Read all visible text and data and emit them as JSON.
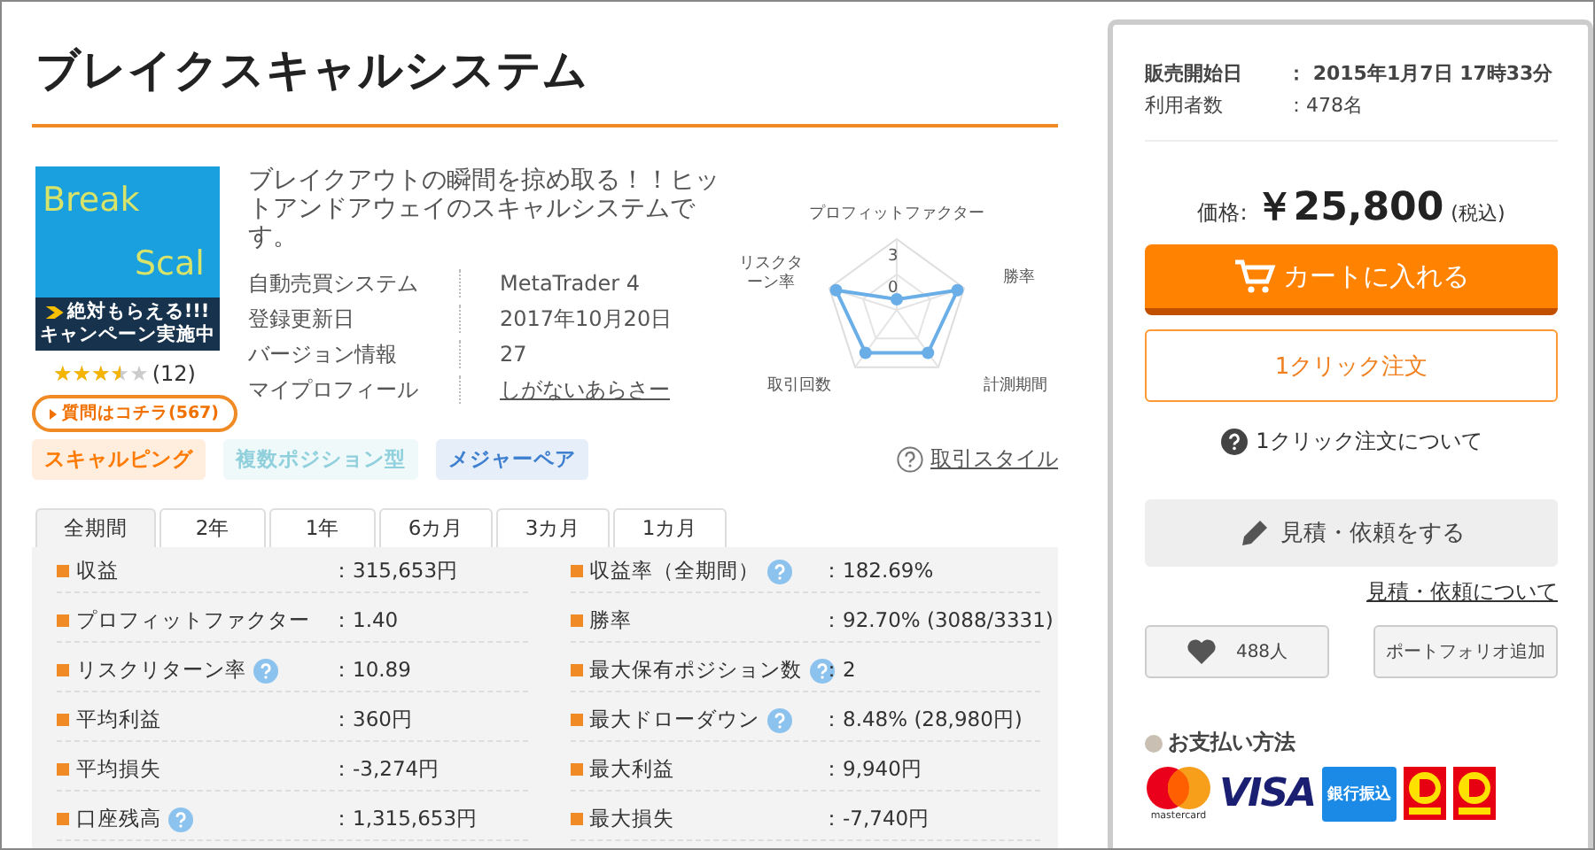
{
  "title": "ブレイクスキャルシステム",
  "product_image": {
    "lines": [
      "Break",
      "Scal"
    ],
    "banner": [
      "絶対もらえる!!!",
      "キャンペーン実施中"
    ]
  },
  "rating": {
    "stars": 3.5,
    "count": "(12)"
  },
  "question_button": "質問はコチラ(567)",
  "description": "ブレイクアウトの瞬間を掠め取る！！ヒットアンドアウェイのスキャルシステムです。",
  "info": [
    {
      "label": "自動売買システム",
      "value": "MetaTrader 4",
      "link": false
    },
    {
      "label": "登録更新日",
      "value": "2017年10月20日",
      "link": false
    },
    {
      "label": "バージョン情報",
      "value": "27",
      "link": false
    },
    {
      "label": "マイプロフィール",
      "value": "しがないあらさー",
      "link": true
    }
  ],
  "radar": {
    "axes": [
      "プロフィットファクター",
      "勝率",
      "計測期間",
      "取引回数",
      "リスクターン率"
    ],
    "ticks": [
      "3",
      "0"
    ]
  },
  "tags": [
    {
      "label": "スキャルピング",
      "color": "#ff7a00"
    },
    {
      "label": "複数ポジション型",
      "color": "#8fd0dc"
    },
    {
      "label": "メジャーペア",
      "color": "#3f7fd0"
    }
  ],
  "style_link": "取引スタイル",
  "tabs": [
    {
      "label": "全期間",
      "selected": true
    },
    {
      "label": "2年",
      "selected": false
    },
    {
      "label": "1年",
      "selected": false
    },
    {
      "label": "6カ月",
      "selected": false
    },
    {
      "label": "3カ月",
      "selected": false
    },
    {
      "label": "1カ月",
      "selected": false
    }
  ],
  "stats": [
    {
      "label": "収益",
      "value": "：315,653円",
      "help": false
    },
    {
      "label": "収益率（全期間）",
      "value": "：182.69%",
      "help": true
    },
    {
      "label": "プロフィットファクター",
      "value": "：1.40",
      "help": false
    },
    {
      "label": "勝率",
      "value": "：92.70% (3088/3331)",
      "help": false
    },
    {
      "label": "リスクリターン率",
      "value": "：10.89",
      "help": true
    },
    {
      "label": "最大保有ポジション数",
      "value": "：2",
      "help": true
    },
    {
      "label": "平均利益",
      "value": "：360円",
      "help": false
    },
    {
      "label": "最大ドローダウン",
      "value": "：8.48% (28,980円)",
      "help": true
    },
    {
      "label": "平均損失",
      "value": "：-3,274円",
      "help": false
    },
    {
      "label": "最大利益",
      "value": "：9,940円",
      "help": false
    },
    {
      "label": "口座残高",
      "value": "：1,315,653円",
      "help": true
    },
    {
      "label": "最大損失",
      "value": "：-7,740円",
      "help": false
    }
  ],
  "sidebar": {
    "details": [
      {
        "label": "販売開始日",
        "value": "： 2015年1月7日 17時33分",
        "bold": true
      },
      {
        "label": "利用者数",
        "value": "：478名",
        "bold": false
      }
    ],
    "price_label": "価格:",
    "price": "￥25,800",
    "tax": "(税込)",
    "cart_button": "カートに入れる",
    "one_click_button": "1クリック注文",
    "one_click_help": "1クリック注文について",
    "quote_button": "見積・依頼をする",
    "quote_link": "見積・依頼について",
    "like_count": "488人",
    "portfolio_button": "ポートフォリオ追加",
    "payment_title": "お支払い方法",
    "payment_methods": [
      {
        "kind": "mastercard",
        "label": "mastercard"
      },
      {
        "kind": "visa",
        "label": "VISA"
      },
      {
        "kind": "bank",
        "label": "銀行振込"
      },
      {
        "kind": "daily"
      },
      {
        "kind": "daily"
      }
    ]
  }
}
